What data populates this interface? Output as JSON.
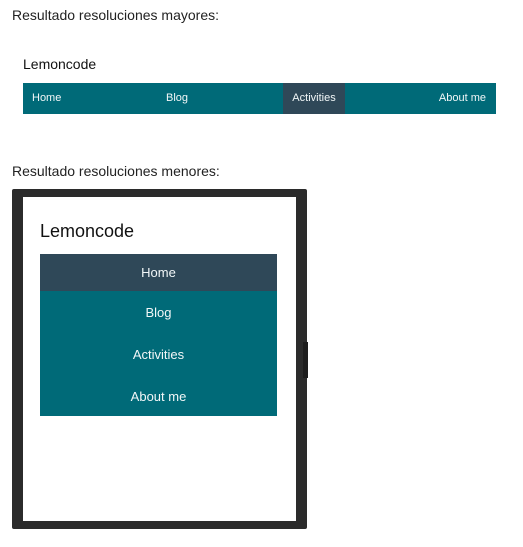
{
  "captions": {
    "desktop": "Resultado resoluciones mayores:",
    "mobile": "Resultado resoluciones menores:"
  },
  "desktop": {
    "brand": "Lemoncode",
    "nav": {
      "items": [
        {
          "label": "Home",
          "active": false
        },
        {
          "label": "Blog",
          "active": false
        },
        {
          "label": "Activities",
          "active": true
        },
        {
          "label": "About me",
          "active": false
        }
      ]
    }
  },
  "mobile": {
    "brand": "Lemoncode",
    "nav": {
      "items": [
        {
          "label": "Home",
          "active": true
        },
        {
          "label": "Blog",
          "active": false
        },
        {
          "label": "Activities",
          "active": false
        },
        {
          "label": "About me",
          "active": false
        }
      ]
    }
  },
  "colors": {
    "nav_background": "#006a78",
    "nav_active_background": "#2f4858",
    "nav_text": "#f2f7f8",
    "device_frame": "#2b2b2b"
  }
}
